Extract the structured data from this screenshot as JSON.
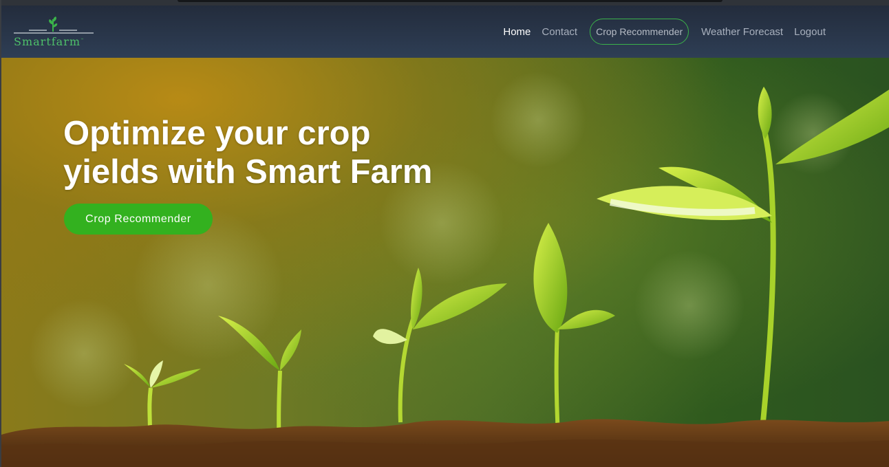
{
  "brand": {
    "name": "Smartfarm",
    "tm": "™",
    "color": "#4ec06a"
  },
  "nav": {
    "items": [
      {
        "label": "Home",
        "active": true
      },
      {
        "label": "Contact",
        "active": false
      },
      {
        "label": "Crop Recommender",
        "active": false,
        "highlighted": true
      },
      {
        "label": "Weather Forecast",
        "active": false
      },
      {
        "label": "Logout",
        "active": false
      }
    ]
  },
  "hero": {
    "headline": "Optimize your crop yields with Smart Farm",
    "cta_label": "Crop Recommender",
    "accent": "#33b11f",
    "image": "seedlings-growing-in-soil"
  }
}
